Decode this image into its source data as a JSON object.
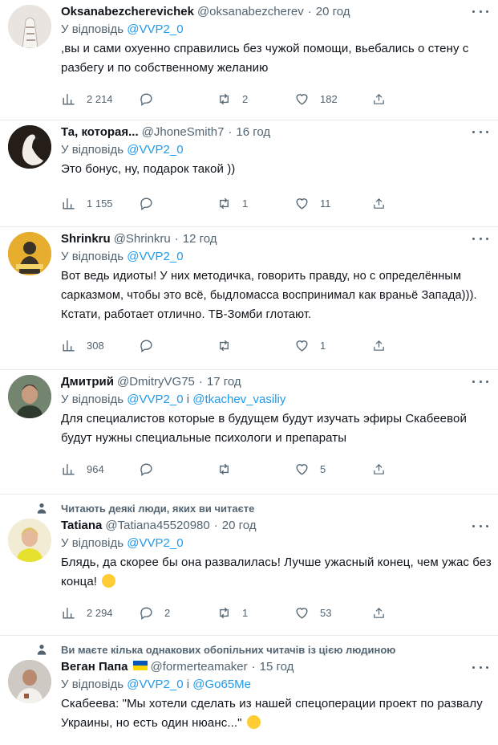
{
  "tweets": [
    {
      "name": "Oksanabezcherevichek",
      "handle": "@oksanabezcherev",
      "time": "20 год",
      "reply_prefix": "У відповідь",
      "reply_to": "@VVP2_0",
      "reply_joiner": "",
      "reply_to2": "",
      "text": ",вы и сами охуенно справились без чужой помощи, вьебались о стену с разбегу и по собственному желанию",
      "views": "2 214",
      "replies": "",
      "retweets": "2",
      "likes": "182",
      "avatar_color": "#d9d3cf"
    },
    {
      "name": "Та, которая...",
      "handle": "@JhoneSmith7",
      "time": "16 год",
      "reply_prefix": "У відповідь",
      "reply_to": "@VVP2_0",
      "reply_joiner": "",
      "reply_to2": "",
      "text": "Это бонус, ну, подарок такой ))",
      "views": "1 155",
      "replies": "",
      "retweets": "1",
      "likes": "11",
      "avatar_color": "#2b2520"
    },
    {
      "name": "Shrinkru",
      "handle": "@Shrinkru",
      "time": "12 год",
      "reply_prefix": "У відповідь",
      "reply_to": "@VVP2_0",
      "reply_joiner": "",
      "reply_to2": "",
      "text": "Вот ведь идиоты! У них методичка, говорить правду, но с определённым сарказмом, чтобы это всё, быдломасса воспринимал как враньё Запада))). Кстати, работает отлично. ТВ-Зомби глотают.",
      "views": "308",
      "replies": "",
      "retweets": "",
      "likes": "1",
      "avatar_color": "#e0a82b"
    },
    {
      "name": "Дмитрий",
      "handle": "@DmitryVG75",
      "time": "17 год",
      "reply_prefix": "У відповідь",
      "reply_to": "@VVP2_0",
      "reply_joiner": "і",
      "reply_to2": "@tkachev_vasiliy",
      "text": "Для специалистов которые в будущем будут изучать эфиры Скабеевой будут нужны специальные психологи и препараты",
      "views": "964",
      "replies": "",
      "retweets": "",
      "likes": "5",
      "avatar_color": "#6b7b6a"
    },
    {
      "social": "Читають деякі люди, яких ви читаєте",
      "name": "Tatiana",
      "handle": "@Tatiana45520980",
      "time": "20 год",
      "reply_prefix": "У відповідь",
      "reply_to": "@VVP2_0",
      "reply_joiner": "",
      "reply_to2": "",
      "text": "Блядь, да скорее бы она развалилась! Лучше ужасный конец, чем ужас без конца!",
      "views": "2 294",
      "replies": "2",
      "retweets": "1",
      "likes": "53",
      "avatar_color": "#e9e3c6"
    },
    {
      "social": "Ви маєте кілька однакових обопільних читачів із цією людиною",
      "name": "Веган Папа",
      "handle": "@formerteamaker",
      "time": "15 год",
      "reply_prefix": "У відповідь",
      "reply_to": "@VVP2_0",
      "reply_joiner": "і",
      "reply_to2": "@Go65Me",
      "text": "Скабеева: \"Мы хотели сделать из нашей спецоперации проект по развалу Украины, но есть один нюанс...\"",
      "views": "",
      "replies": "",
      "retweets": "",
      "likes": "",
      "avatar_color": "#c9c4c0"
    }
  ],
  "icons": {
    "views": "bar-chart-icon",
    "reply": "speech-bubble-icon",
    "retweet": "retweet-icon",
    "like": "heart-icon",
    "share": "share-icon"
  },
  "colors": {
    "link": "#1d9bf0",
    "muted": "#536471",
    "text": "#0f1419",
    "divider": "#e6ecf0"
  }
}
